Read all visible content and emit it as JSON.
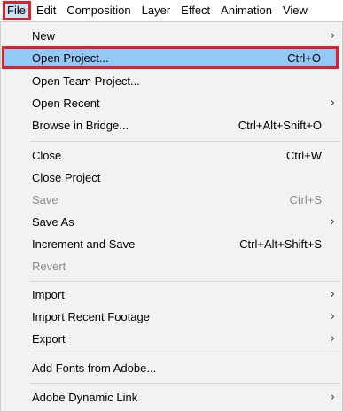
{
  "menubar": {
    "items": [
      "File",
      "Edit",
      "Composition",
      "Layer",
      "Effect",
      "Animation",
      "View"
    ]
  },
  "menu": {
    "new": {
      "label": "New",
      "submenu_glyph": "›"
    },
    "open_project": {
      "label": "Open Project...",
      "shortcut": "Ctrl+O"
    },
    "open_team_project": {
      "label": "Open Team Project..."
    },
    "open_recent": {
      "label": "Open Recent",
      "submenu_glyph": "›"
    },
    "browse_bridge": {
      "label": "Browse in Bridge...",
      "shortcut": "Ctrl+Alt+Shift+O"
    },
    "close": {
      "label": "Close",
      "shortcut": "Ctrl+W"
    },
    "close_project": {
      "label": "Close Project"
    },
    "save": {
      "label": "Save",
      "shortcut": "Ctrl+S"
    },
    "save_as": {
      "label": "Save As",
      "submenu_glyph": "›"
    },
    "increment_save": {
      "label": "Increment and Save",
      "shortcut": "Ctrl+Alt+Shift+S"
    },
    "revert": {
      "label": "Revert"
    },
    "import": {
      "label": "Import",
      "submenu_glyph": "›"
    },
    "import_recent": {
      "label": "Import Recent Footage",
      "submenu_glyph": "›"
    },
    "export": {
      "label": "Export",
      "submenu_glyph": "›"
    },
    "add_fonts": {
      "label": "Add Fonts from Adobe..."
    },
    "dynamic_link": {
      "label": "Adobe Dynamic Link",
      "submenu_glyph": "›"
    }
  },
  "colors": {
    "highlight_bg": "#91c9f7",
    "annotation_red": "#e0202a",
    "menu_bg": "#f2f2f2",
    "disabled_text": "#8c8c8c"
  }
}
